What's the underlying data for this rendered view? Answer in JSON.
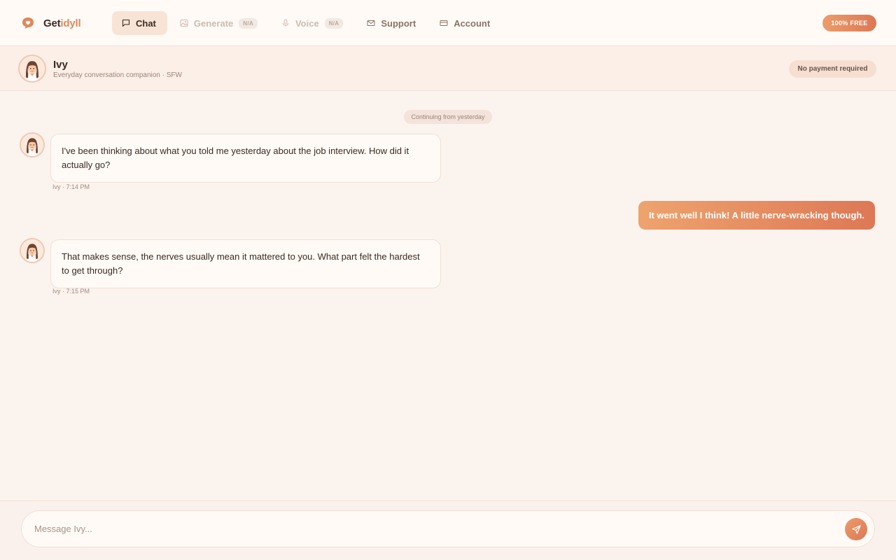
{
  "brand": {
    "name_part1": "Get",
    "name_part2": "idyll"
  },
  "nav": {
    "items": [
      {
        "label": "Chat",
        "icon": "chat-icon"
      },
      {
        "label": "Generate",
        "icon": "image-icon",
        "badge": "N/A"
      },
      {
        "label": "Voice",
        "icon": "mic-icon",
        "badge": "N/A"
      },
      {
        "label": "Support",
        "icon": "mail-icon"
      },
      {
        "label": "Account",
        "icon": "card-icon"
      }
    ],
    "free_badge": "100% FREE"
  },
  "companion": {
    "name": "Ivy",
    "subtitle": "Everyday conversation companion · SFW",
    "status_pill": "No payment required"
  },
  "chat": {
    "divider": "Continuing from yesterday",
    "messages": [
      {
        "from": "bot",
        "text": "I've been thinking about what you told me yesterday about the job interview. How did it actually go?",
        "meta": "Ivy · 7:14 PM"
      },
      {
        "from": "user",
        "text": "It went well I think! A little nerve-wracking though."
      },
      {
        "from": "bot",
        "text": "That makes sense, the nerves usually mean it mattered to you. What part felt the hardest to get through?",
        "meta": "Ivy · 7:15 PM"
      }
    ]
  },
  "composer": {
    "placeholder": "Message Ivy...",
    "value": ""
  },
  "colors": {
    "accent": "#e0875c",
    "background": "#fbf3ee",
    "user_bubble_start": "#eea36d",
    "user_bubble_end": "#dd7856"
  }
}
